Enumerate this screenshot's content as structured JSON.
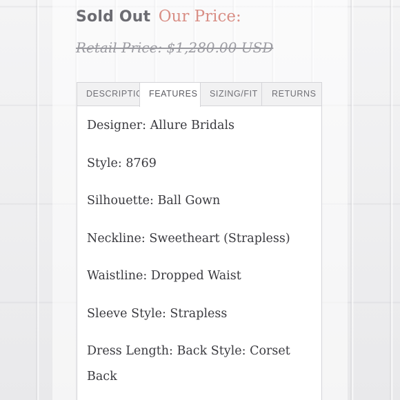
{
  "pricing": {
    "status": "Sold Out",
    "our_price_label": "Our Price:",
    "retail_price": "Retail Price: $1,280.00 USD"
  },
  "tabs": [
    {
      "label": "DESCRIPTION",
      "active": false
    },
    {
      "label": "FEATURES",
      "active": true
    },
    {
      "label": "SIZING/FIT",
      "active": false
    },
    {
      "label": "RETURNS",
      "active": false
    }
  ],
  "features": [
    "Designer: Allure Bridals",
    "Style: 8769",
    "Silhouette: Ball Gown",
    "Neckline: Sweetheart (Strapless)",
    "Waistline: Dropped Waist",
    "Sleeve Style: Strapless",
    "Dress Length: Back Style: Corset Back"
  ],
  "colors": {
    "status": "#6c6c72",
    "our_price": "#d98f86",
    "retail_price": "#9b9ba1",
    "feature_text": "#3a3a3f",
    "tab_border": "#d4d4d8"
  }
}
